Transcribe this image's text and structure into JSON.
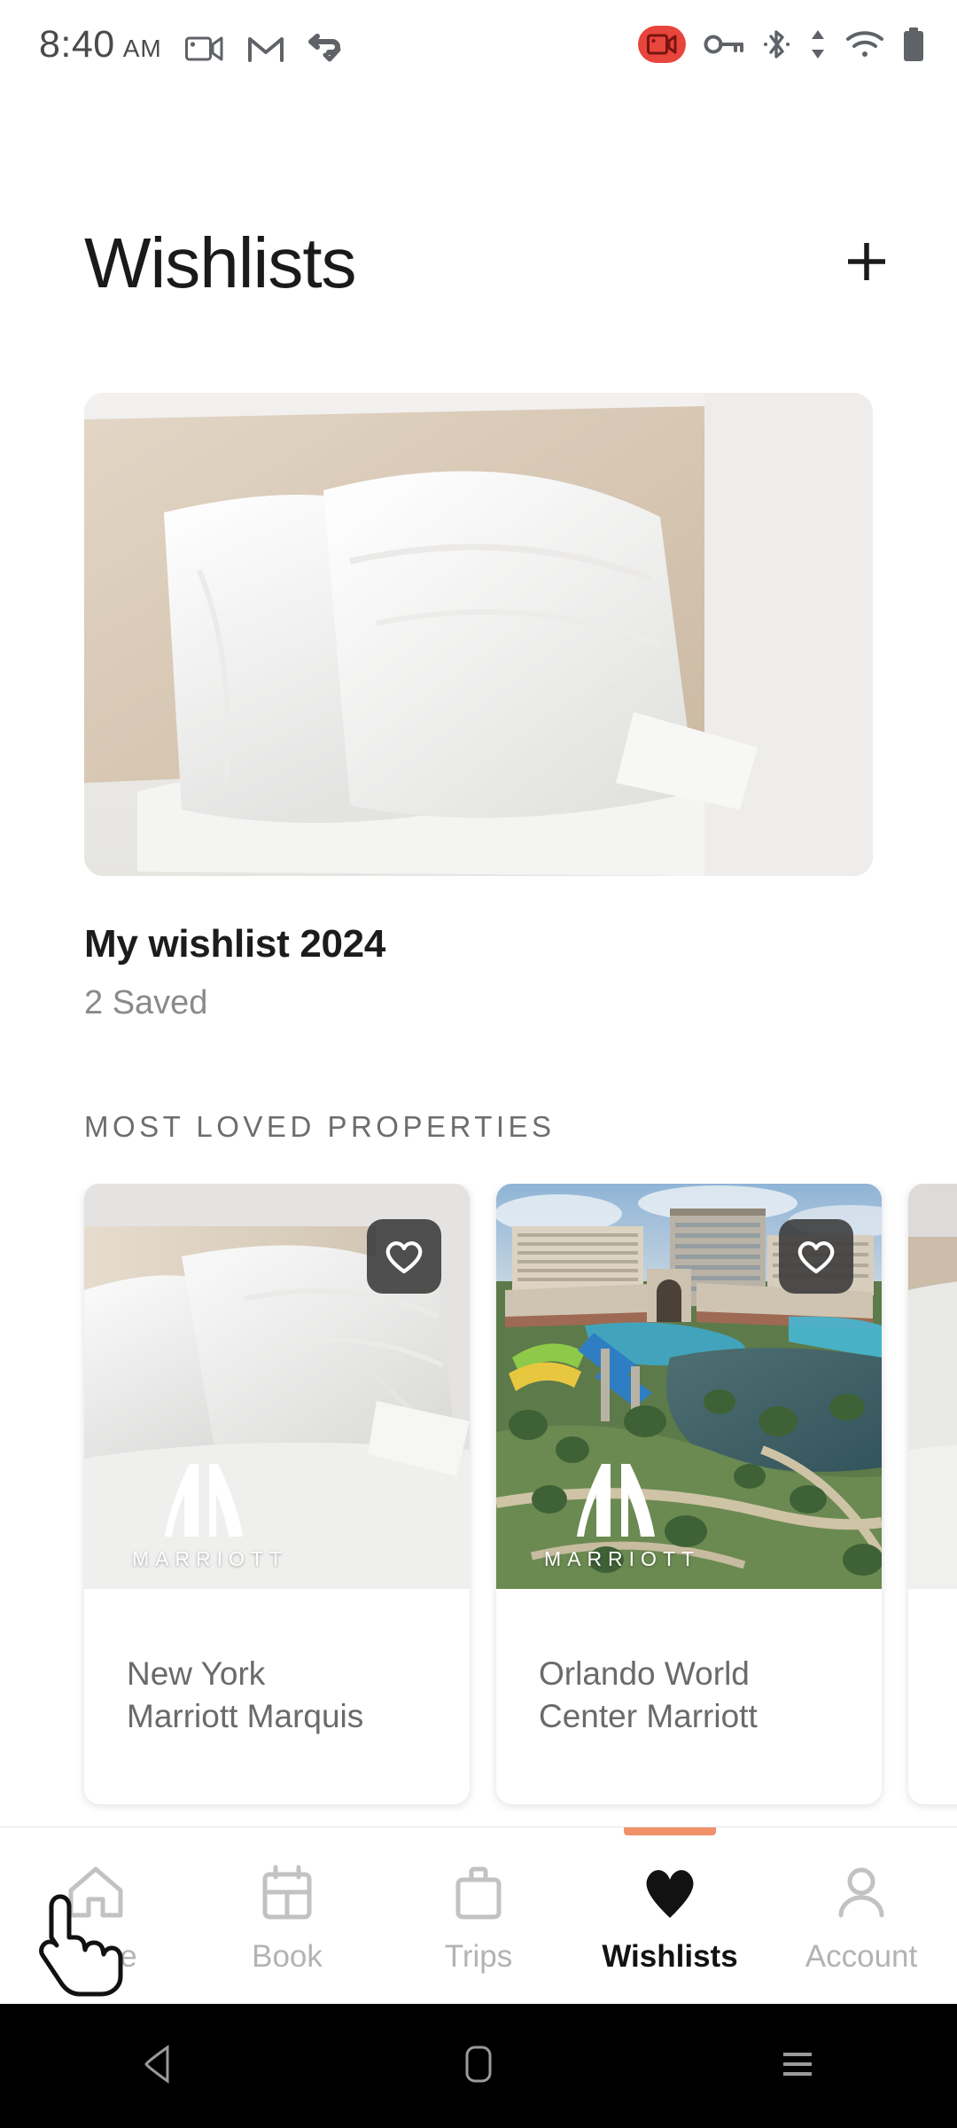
{
  "status_bar": {
    "time": "8:40",
    "meridiem": "AM",
    "left_icons": [
      "screen-record-icon",
      "gmail-icon",
      "sync-check-icon"
    ],
    "right_icons": [
      "recording-badge-icon",
      "vpn-key-icon",
      "bluetooth-icon",
      "data-transfer-icon",
      "wifi-icon",
      "battery-icon"
    ],
    "recording_badge_color": "#E8453C",
    "icon_color": "#5f6368"
  },
  "header": {
    "title": "Wishlists",
    "add_button_label": "+"
  },
  "wishlist": {
    "image_alt": "white-pillows-on-bed",
    "name": "My wishlist 2024",
    "saved_count": "2 Saved"
  },
  "section": {
    "label": "MOST LOVED PROPERTIES"
  },
  "properties": [
    {
      "name": "New York\nMarriott Marquis",
      "line1": "New York",
      "line2": "Marriott Marquis",
      "brand": "MARRIOTT",
      "favorite_icon": "heart-outline-icon",
      "favorited": false,
      "image_alt": "hotel-bed-with-white-pillows"
    },
    {
      "name": "Orlando World\nCenter Marriott",
      "line1": "Orlando World",
      "line2": "Center Marriott",
      "brand": "MARRIOTT",
      "favorite_icon": "heart-outline-icon",
      "favorited": false,
      "image_alt": "aerial-view-of-resort-with-pools-and-lake"
    },
    {
      "name": "",
      "line1": "",
      "line2": "",
      "brand": "",
      "favorite_icon": "heart-outline-icon",
      "favorited": false,
      "image_alt": "partially-visible-hotel-room-card"
    }
  ],
  "bottom_nav": {
    "active_indicator_color": "#F0916A",
    "items": [
      {
        "label": "Home",
        "icon": "home-icon",
        "active": false
      },
      {
        "label": "Book",
        "icon": "calendar-icon",
        "active": false
      },
      {
        "label": "Trips",
        "icon": "briefcase-icon",
        "active": false
      },
      {
        "label": "Wishlists",
        "icon": "heart-filled-icon",
        "active": true
      },
      {
        "label": "Account",
        "icon": "person-icon",
        "active": false
      }
    ]
  },
  "system_nav": {
    "back": "back-triangle-icon",
    "home": "home-pill-icon",
    "recents": "recents-lines-icon"
  },
  "cursor": {
    "type": "pointing-hand-cursor"
  }
}
